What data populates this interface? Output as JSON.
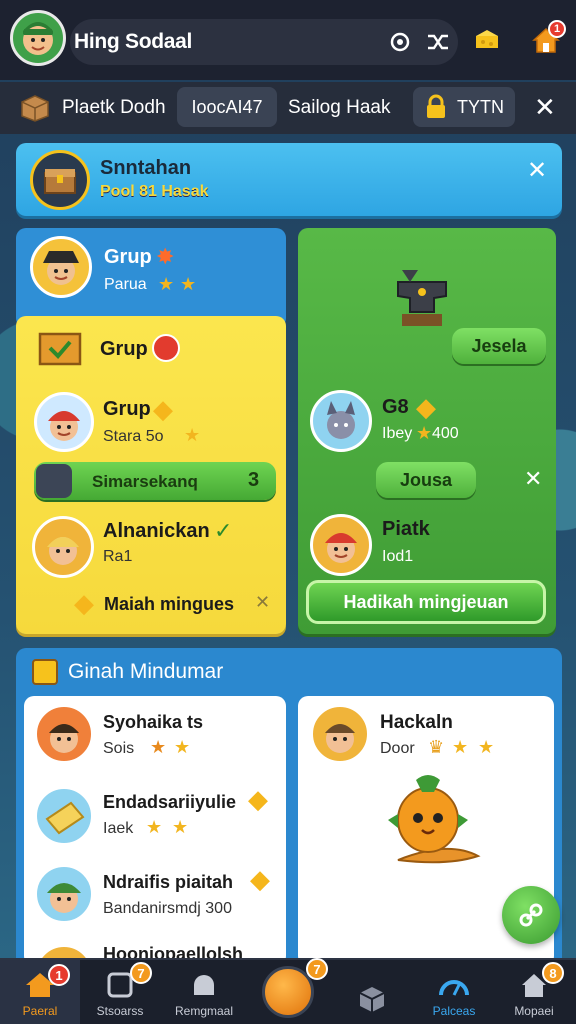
{
  "topbar": {
    "title": "Hing Sodaal",
    "icons": [
      "avatar",
      "target-icon",
      "shuffle-icon",
      "cheese-icon",
      "house-icon"
    ],
    "house_badge": "1"
  },
  "subbar": {
    "item1_label": "Plaetk Dodh",
    "chip_label": "IoocAI47",
    "item3_label": "Sailog Haak",
    "lock_label": "TYTN"
  },
  "banner": {
    "title": "Snntahan",
    "subtitle": "Pool 81 Hasak"
  },
  "left_top": {
    "name": "Grup",
    "sub": "Parua"
  },
  "left_yellow": {
    "header": "Grup",
    "member1_name": "Grup",
    "member1_sub": "Stara 5o",
    "progress_label": "Simarsekanq",
    "progress_count": "3",
    "member2_name": "Alnanickan",
    "member2_sub": "Ra1",
    "footer_label": "Maiah mingues"
  },
  "right_green": {
    "join_button1": "Jesela",
    "member1_name": "G8",
    "member1_sub": "Ibey",
    "member1_score": "400",
    "join_button2": "Jousa",
    "member2_name": "Piatk",
    "member2_sub": "Iod1",
    "big_button": "Hadikah mingjeuan"
  },
  "bottom": {
    "header": "Ginah Mindumar",
    "list": [
      {
        "name": "Syohaika ts",
        "sub": "Sois"
      },
      {
        "name": "Endadsariiyulie",
        "sub": "Iaek"
      },
      {
        "name": "Ndraifis piaitah",
        "sub": "Bandanirsmdj 300"
      },
      {
        "name": "Hooniopaellolsh",
        "sub": ""
      }
    ],
    "featured_name": "Hackaln",
    "featured_sub": "Door"
  },
  "navbar": {
    "items": [
      {
        "label": "Paeral",
        "badge": "1"
      },
      {
        "label": "Stsoarss",
        "badge": "7"
      },
      {
        "label": "Remgmaal",
        "badge": ""
      },
      {
        "label": "",
        "badge": "7"
      },
      {
        "label": "",
        "badge": ""
      },
      {
        "label": "Palceas",
        "badge": ""
      },
      {
        "label": "Mopaei",
        "badge": "8"
      }
    ]
  },
  "colors": {
    "accent_blue": "#2ea5e3",
    "yellow_panel": "#f6d93c",
    "green_panel": "#3f9c35",
    "nav_bg": "#1b202c",
    "badge_orange": "#f39a1e"
  }
}
